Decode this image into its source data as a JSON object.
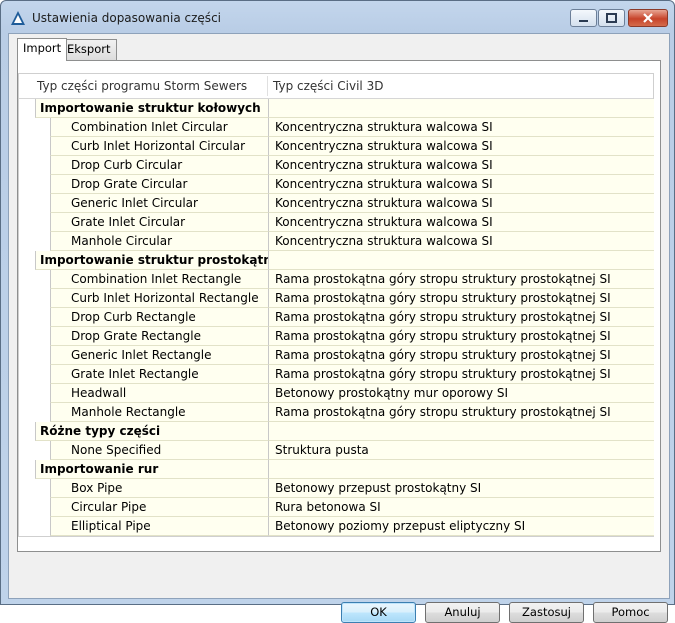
{
  "window": {
    "title": "Ustawienia dopasowania części"
  },
  "tabs": [
    {
      "label": "Import",
      "active": true
    },
    {
      "label": "Eksport",
      "active": false
    }
  ],
  "grid": {
    "columns": [
      "Typ części programu Storm Sewers",
      "Typ części Civil 3D"
    ],
    "rows": [
      {
        "type": "group",
        "col1": "Importowanie struktur kołowych",
        "col2": ""
      },
      {
        "type": "item",
        "col1": "Combination Inlet Circular",
        "col2": "Koncentryczna struktura walcowa SI"
      },
      {
        "type": "item",
        "col1": "Curb Inlet Horizontal Circular",
        "col2": "Koncentryczna struktura walcowa SI"
      },
      {
        "type": "item",
        "col1": "Drop Curb Circular",
        "col2": "Koncentryczna struktura walcowa SI"
      },
      {
        "type": "item",
        "col1": "Drop Grate Circular",
        "col2": "Koncentryczna struktura walcowa SI"
      },
      {
        "type": "item",
        "col1": "Generic Inlet Circular",
        "col2": "Koncentryczna struktura walcowa SI"
      },
      {
        "type": "item",
        "col1": "Grate Inlet Circular",
        "col2": "Koncentryczna struktura walcowa SI"
      },
      {
        "type": "item",
        "col1": "Manhole Circular",
        "col2": "Koncentryczna struktura walcowa SI"
      },
      {
        "type": "group",
        "col1": "Importowanie struktur prostokątnych",
        "col2": ""
      },
      {
        "type": "item",
        "col1": "Combination Inlet Rectangle",
        "col2": "Rama prostokątna góry stropu struktury prostokątnej SI"
      },
      {
        "type": "item",
        "col1": "Curb Inlet Horizontal Rectangle",
        "col2": "Rama prostokątna góry stropu struktury prostokątnej SI"
      },
      {
        "type": "item",
        "col1": "Drop Curb Rectangle",
        "col2": "Rama prostokątna góry stropu struktury prostokątnej SI"
      },
      {
        "type": "item",
        "col1": "Drop Grate Rectangle",
        "col2": "Rama prostokątna góry stropu struktury prostokątnej SI"
      },
      {
        "type": "item",
        "col1": "Generic Inlet Rectangle",
        "col2": "Rama prostokątna góry stropu struktury prostokątnej SI"
      },
      {
        "type": "item",
        "col1": "Grate Inlet Rectangle",
        "col2": "Rama prostokątna góry stropu struktury prostokątnej SI"
      },
      {
        "type": "item",
        "col1": "Headwall",
        "col2": "Betonowy prostokątny mur oporowy SI"
      },
      {
        "type": "item",
        "col1": "Manhole Rectangle",
        "col2": "Rama prostokątna góry stropu struktury prostokątnej SI"
      },
      {
        "type": "group",
        "col1": "Różne typy części",
        "col2": ""
      },
      {
        "type": "item",
        "col1": "None Specified",
        "col2": "Struktura pusta"
      },
      {
        "type": "group",
        "col1": "Importowanie rur",
        "col2": ""
      },
      {
        "type": "item",
        "col1": "Box Pipe",
        "col2": "Betonowy przepust prostokątny SI"
      },
      {
        "type": "item",
        "col1": "Circular Pipe",
        "col2": "Rura betonowa SI"
      },
      {
        "type": "item",
        "col1": "Elliptical Pipe",
        "col2": "Betonowy poziomy przepust eliptyczny SI"
      }
    ]
  },
  "buttons": {
    "ok": "OK",
    "cancel": "Anuluj",
    "apply": "Zastosuj",
    "help": "Pomoc"
  }
}
